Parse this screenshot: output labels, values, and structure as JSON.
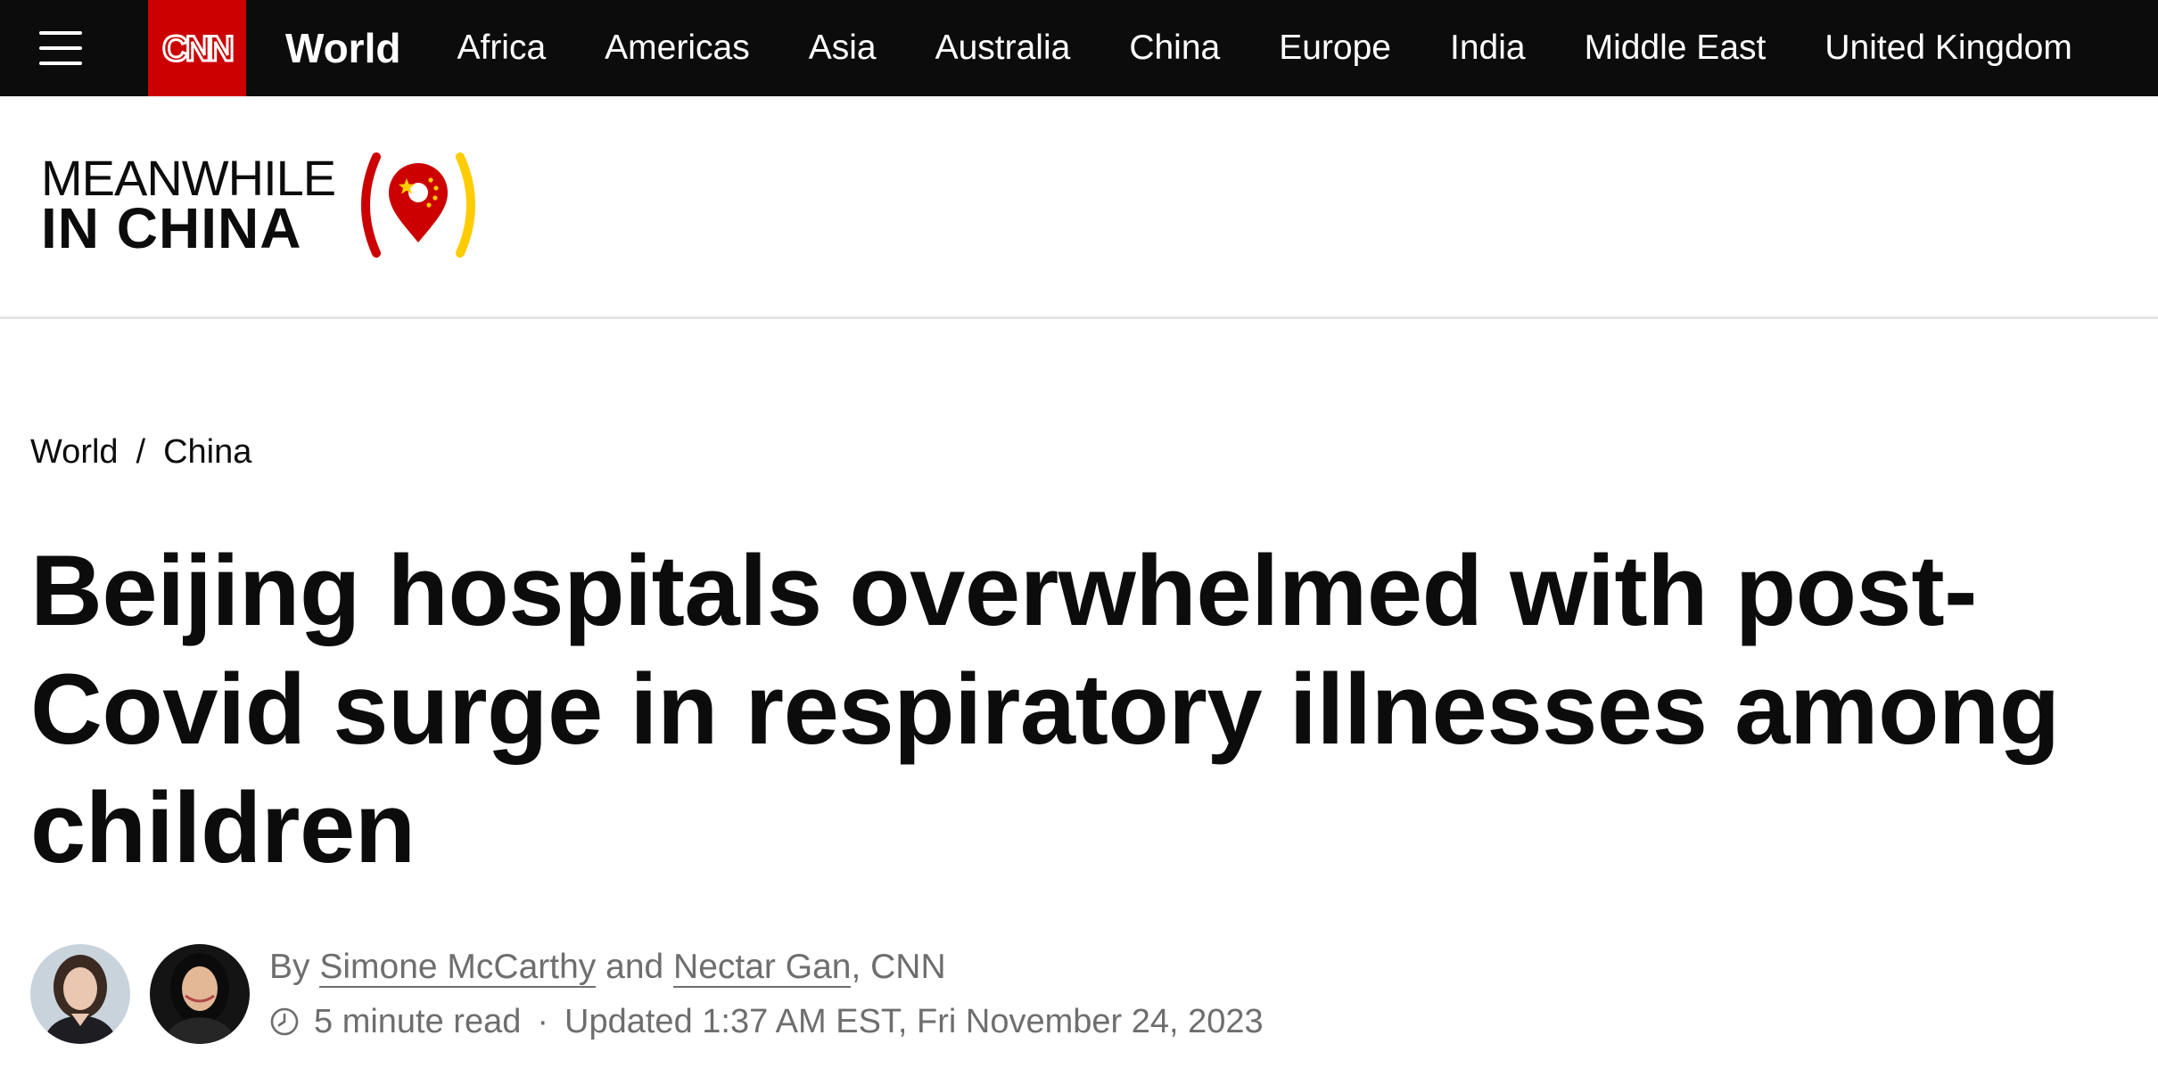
{
  "topnav": {
    "logo_text": "CNN",
    "section": "World",
    "links": [
      "Africa",
      "Americas",
      "Asia",
      "Australia",
      "China",
      "Europe",
      "India",
      "Middle East",
      "United Kingdom"
    ]
  },
  "banner": {
    "line1": "MEANWHILE",
    "line2": "IN CHINA",
    "mark_icon": "location-pin-china-flag-icon"
  },
  "breadcrumb": {
    "items": [
      "World",
      "China"
    ],
    "separator": "/"
  },
  "article": {
    "headline": "Beijing hospitals overwhelmed with post-Covid surge in respiratory illnesses among children",
    "byline_prefix": "By",
    "author1": "Simone McCarthy",
    "and": "and",
    "author2": "Nectar Gan",
    "outlet": ", CNN",
    "read_time": "5 minute read",
    "separator": "·",
    "updated": "Updated 1:37 AM EST, Fri November 24, 2023",
    "clock_icon": "clock-icon"
  },
  "colors": {
    "nav_bg": "#0c0c0c",
    "brand_red": "#cc0000",
    "flag_yellow": "#ffcc00",
    "meta_gray": "#6e6e6e"
  }
}
